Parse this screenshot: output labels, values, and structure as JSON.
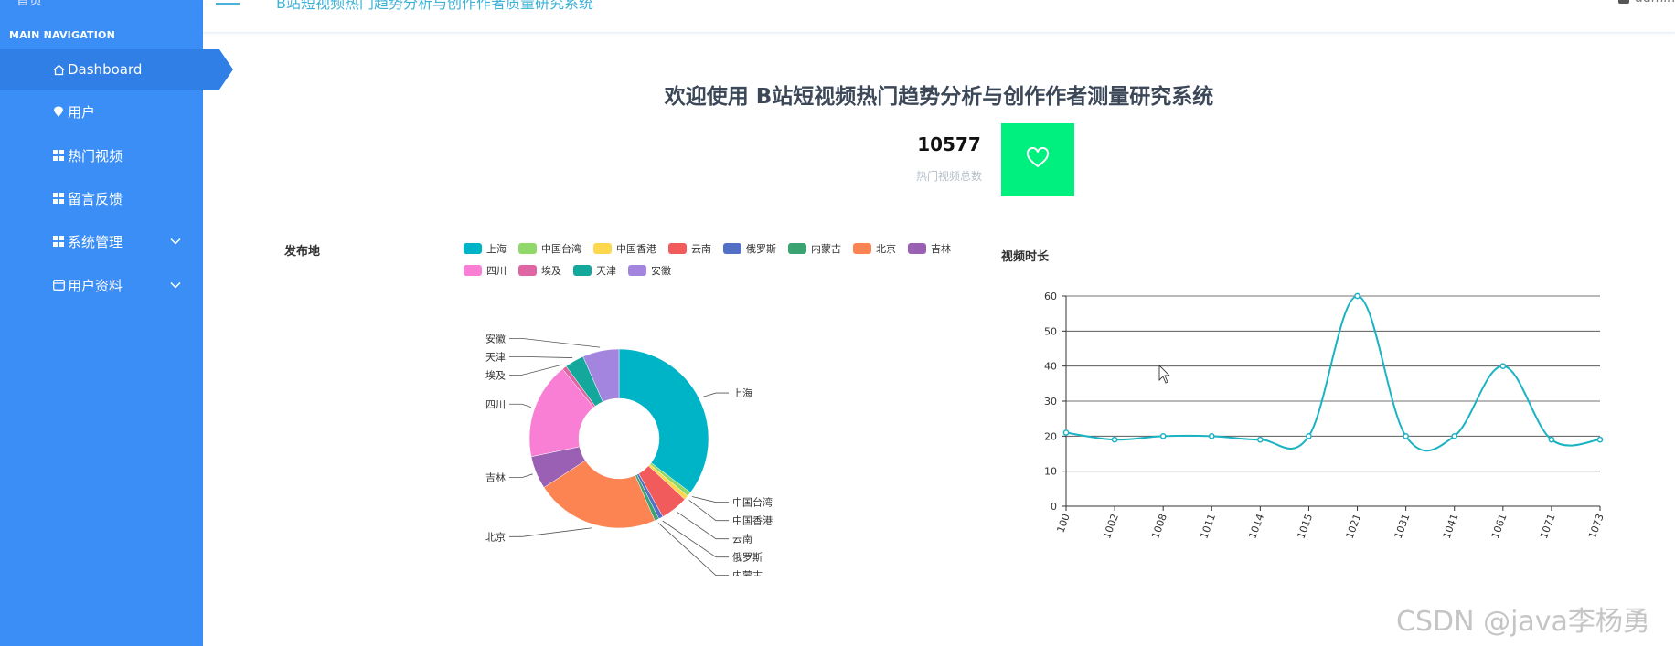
{
  "sidebar": {
    "brand": "首页",
    "nav_title": "MAIN NAVIGATION",
    "items": [
      {
        "label": "Dashboard",
        "icon": "home-icon"
      },
      {
        "label": "用户",
        "icon": "pin-icon"
      },
      {
        "label": "热门视频",
        "icon": "grid-icon"
      },
      {
        "label": "留言反馈",
        "icon": "grid-icon"
      },
      {
        "label": "系统管理",
        "icon": "grid-icon",
        "chevron": "chevron-down-icon"
      },
      {
        "label": "用户资料",
        "icon": "card-icon",
        "chevron": "chevron-down-icon"
      }
    ]
  },
  "header": {
    "title": "B站短视频热门趋势分析与创作作者质量研究系统",
    "user": "admin"
  },
  "welcome": "欢迎使用 B站短视频热门趋势分析与创作作者测量研究系统",
  "stat": {
    "value": "10577",
    "label": "热门视频总数",
    "icon": "heart-icon",
    "color": "#00f080"
  },
  "watermark": "CSDN @java李杨勇",
  "chart_data": [
    {
      "type": "pie",
      "title": "发布地",
      "legend_position": "top",
      "slices": [
        {
          "name": "上海",
          "value": 35.5,
          "color": "#00b4c8"
        },
        {
          "name": "中国台湾",
          "value": 0.8,
          "color": "#91d86a"
        },
        {
          "name": "中国香港",
          "value": 0.8,
          "color": "#fdd84e"
        },
        {
          "name": "云南",
          "value": 5,
          "color": "#f25b5b"
        },
        {
          "name": "俄罗斯",
          "value": 0.8,
          "color": "#5470c6"
        },
        {
          "name": "内蒙古",
          "value": 0.8,
          "color": "#3ba272"
        },
        {
          "name": "北京",
          "value": 22.5,
          "color": "#fc8452"
        },
        {
          "name": "吉林",
          "value": 6,
          "color": "#9a60b4"
        },
        {
          "name": "四川",
          "value": 17.5,
          "color": "#f87fd4"
        },
        {
          "name": "埃及",
          "value": 0.8,
          "color": "#e066a3"
        },
        {
          "name": "天津",
          "value": 3.5,
          "color": "#14a89d"
        },
        {
          "name": "安徽",
          "value": 6.6,
          "color": "#a385e0"
        }
      ]
    },
    {
      "type": "line",
      "title": "视频时长",
      "x": [
        "100",
        "1002",
        "1008",
        "1011",
        "1014",
        "1015",
        "1021",
        "1031",
        "1041",
        "1061",
        "1071",
        "1073"
      ],
      "values": [
        21,
        19,
        20,
        20,
        19,
        20,
        60,
        20,
        20,
        40,
        19,
        19
      ],
      "ylim": [
        0,
        60
      ],
      "yticks": [
        0,
        10,
        20,
        30,
        40,
        50,
        60
      ],
      "grid": true,
      "smooth": true,
      "color": "#1ab3c3"
    }
  ]
}
